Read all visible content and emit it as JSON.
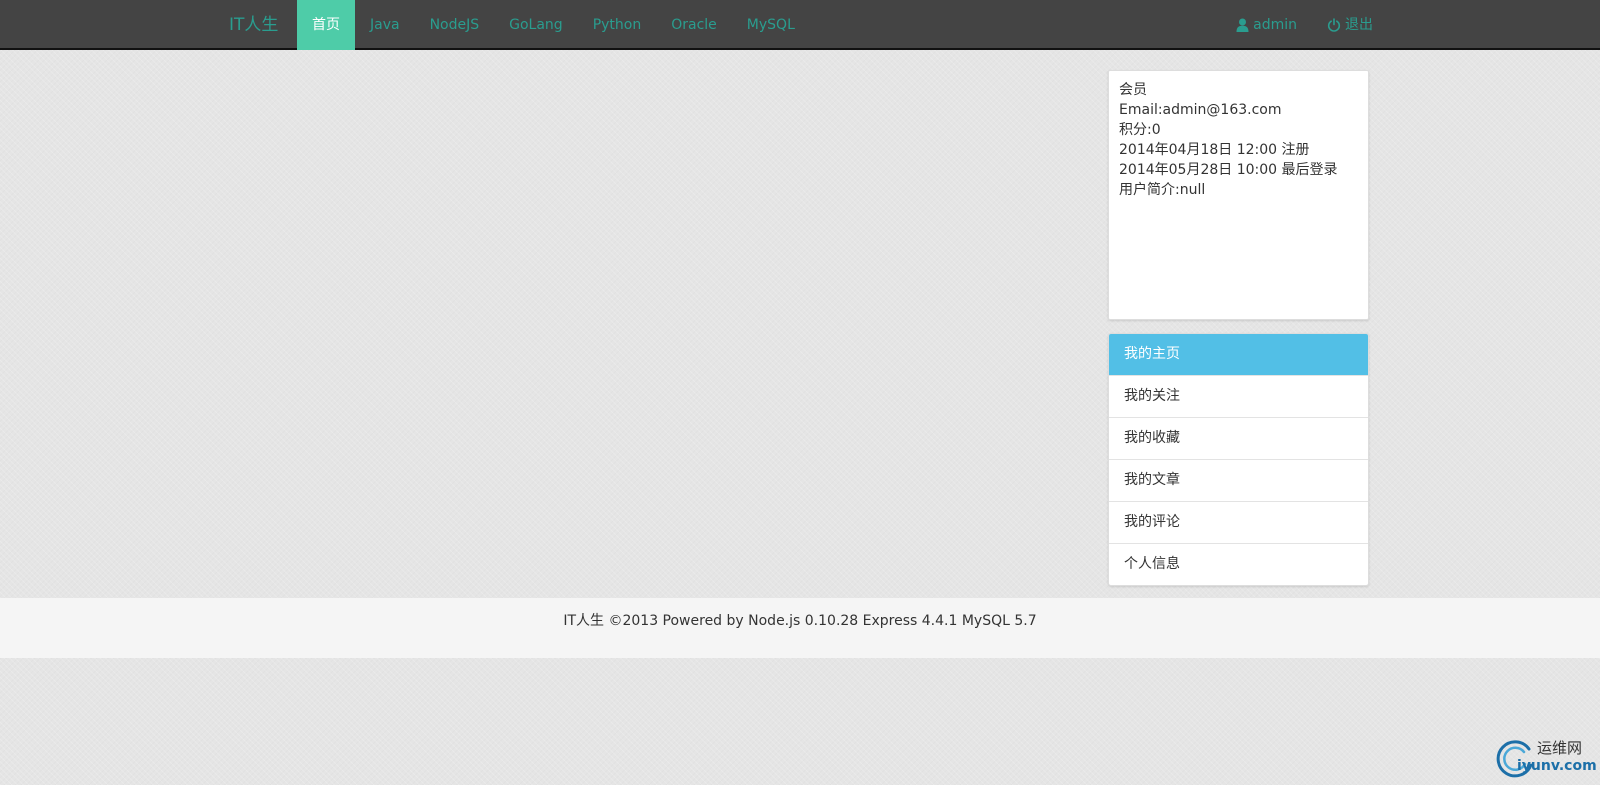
{
  "navbar": {
    "brand": "IT人生",
    "items": [
      {
        "label": "首页",
        "active": true
      },
      {
        "label": "Java",
        "active": false
      },
      {
        "label": "NodeJS",
        "active": false
      },
      {
        "label": "GoLang",
        "active": false
      },
      {
        "label": "Python",
        "active": false
      },
      {
        "label": "Oracle",
        "active": false
      },
      {
        "label": "MySQL",
        "active": false
      }
    ],
    "user": {
      "label": "admin",
      "icon": "user-icon"
    },
    "logout": {
      "label": "退出",
      "icon": "power-icon"
    }
  },
  "profile": {
    "role": "会员",
    "email": "Email:admin@163.com",
    "points": "积分:0",
    "registered": "2014年04月18日 12:00 注册",
    "last_login": "2014年05月28日 10:00 最后登录",
    "bio": "用户简介:null"
  },
  "menu": {
    "items": [
      {
        "label": "我的主页",
        "active": true
      },
      {
        "label": "我的关注",
        "active": false
      },
      {
        "label": "我的收藏",
        "active": false
      },
      {
        "label": "我的文章",
        "active": false
      },
      {
        "label": "我的评论",
        "active": false
      },
      {
        "label": "个人信息",
        "active": false
      }
    ]
  },
  "footer": {
    "text": "IT人生 ©2013 Powered by Node.js 0.10.28 Express 4.4.1 MySQL 5.7"
  },
  "watermark": {
    "text_cn": "运维网",
    "text_en": "iyunv.com"
  },
  "colors": {
    "navbar_bg": "#444444",
    "nav_link": "#2a9d8f",
    "nav_active_bg": "#4ecca8",
    "menu_active_bg": "#52bfe6",
    "page_bg": "#e5e5e5",
    "footer_bg": "#f5f5f5"
  }
}
